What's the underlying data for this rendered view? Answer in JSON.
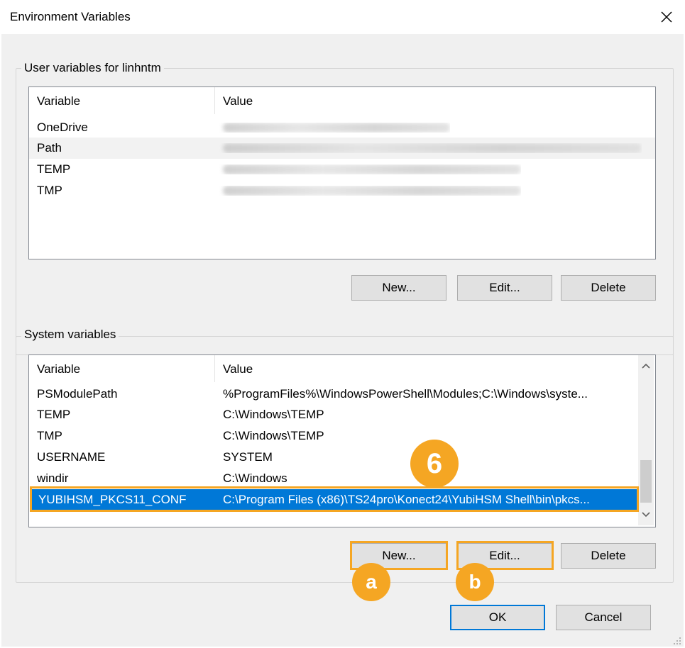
{
  "window": {
    "title": "Environment Variables"
  },
  "user_section": {
    "legend": "User variables for linhntm",
    "columns": [
      "Variable",
      "Value"
    ],
    "rows": [
      {
        "variable": "OneDrive",
        "value": ""
      },
      {
        "variable": "Path",
        "value": ""
      },
      {
        "variable": "TEMP",
        "value": ""
      },
      {
        "variable": "TMP",
        "value": ""
      }
    ],
    "buttons": {
      "new": "New...",
      "edit": "Edit...",
      "delete": "Delete"
    }
  },
  "system_section": {
    "legend": "System variables",
    "columns": [
      "Variable",
      "Value"
    ],
    "rows": [
      {
        "variable": "PSModulePath",
        "value": "%ProgramFiles%\\WindowsPowerShell\\Modules;C:\\Windows\\syste..."
      },
      {
        "variable": "TEMP",
        "value": "C:\\Windows\\TEMP"
      },
      {
        "variable": "TMP",
        "value": "C:\\Windows\\TEMP"
      },
      {
        "variable": "USERNAME",
        "value": "SYSTEM"
      },
      {
        "variable": "windir",
        "value": "C:\\Windows"
      },
      {
        "variable": "YUBIHSM_PKCS11_CONF",
        "value": "C:\\Program Files (x86)\\TS24pro\\Konect24\\YubiHSM Shell\\bin\\pkcs..."
      }
    ],
    "buttons": {
      "new": "New...",
      "edit": "Edit...",
      "delete": "Delete"
    }
  },
  "dialog_buttons": {
    "ok": "OK",
    "cancel": "Cancel"
  },
  "annotations": {
    "step": "6",
    "a": "a",
    "b": "b"
  },
  "colors": {
    "accent": "#0078d7",
    "annotation": "#f5a623",
    "selection": "#0078d7"
  },
  "icons": {
    "close": "close-icon",
    "scroll_up": "chevron-up-icon",
    "scroll_down": "chevron-down-icon"
  }
}
